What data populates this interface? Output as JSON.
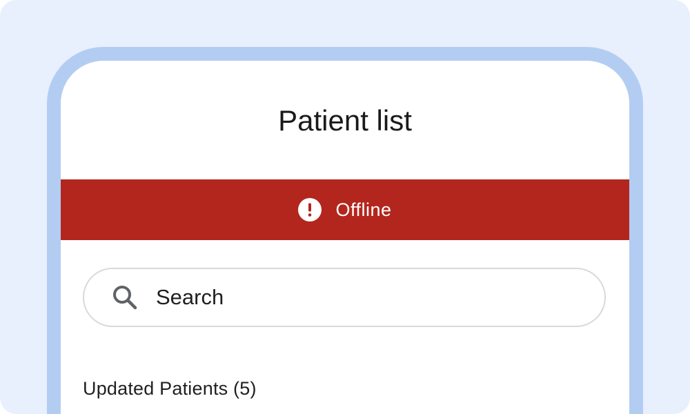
{
  "header": {
    "title": "Patient list"
  },
  "status_banner": {
    "label": "Offline",
    "icon": "alert-circle-icon",
    "background_color": "#b3261e"
  },
  "search": {
    "placeholder": "Search",
    "icon": "search-icon"
  },
  "list": {
    "section_heading": "Updated Patients (5)"
  },
  "colors": {
    "page_background": "#e8effd",
    "device_frame": "#b3cdf2",
    "screen": "#ffffff"
  }
}
